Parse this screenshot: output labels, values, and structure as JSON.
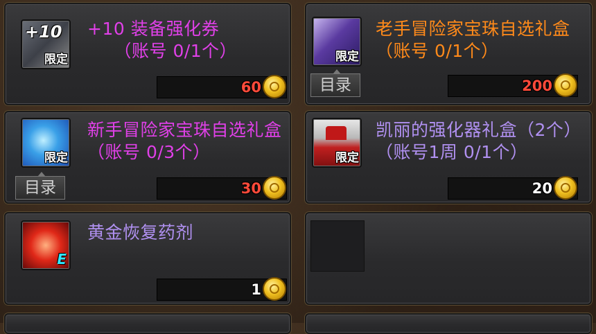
{
  "items": [
    {
      "title": "+10 装备强化券\n　　（账号 0/1个）",
      "price": "60",
      "limited": "限定",
      "title_color": "#e040e8",
      "price_color": "#ff4a3a",
      "icon": "plus10-scroll-icon",
      "icon_text": "+10"
    },
    {
      "title": "老手冒险家宝珠自选礼盒　　（账号 0/1个）",
      "price": "200",
      "limited": "限定",
      "title_color": "#ff8a1a",
      "price_color": "#ff4a3a",
      "icon": "veteran-orb-box-icon",
      "catalog": "目录"
    },
    {
      "title": "新手冒险家宝珠自选礼盒　（账号 0/3个）",
      "price": "30",
      "limited": "限定",
      "title_color": "#e040e8",
      "price_color": "#ff4a3a",
      "icon": "novice-orb-box-icon",
      "catalog": "目录"
    },
    {
      "title": "凯丽的强化器礼盒（2个）（账号1周 0/1个）",
      "price": "20",
      "limited": "限定",
      "title_color": "#b090f0",
      "price_color": "#ffffff",
      "icon": "kiri-enhancer-box-icon"
    },
    {
      "title": "黄金恢复药剂",
      "price": "1",
      "title_color": "#b090f0",
      "price_color": "#ffffff",
      "icon": "golden-recovery-potion-icon",
      "icon_badge": "E"
    }
  ],
  "colors": {
    "coin": "#f0c020"
  }
}
